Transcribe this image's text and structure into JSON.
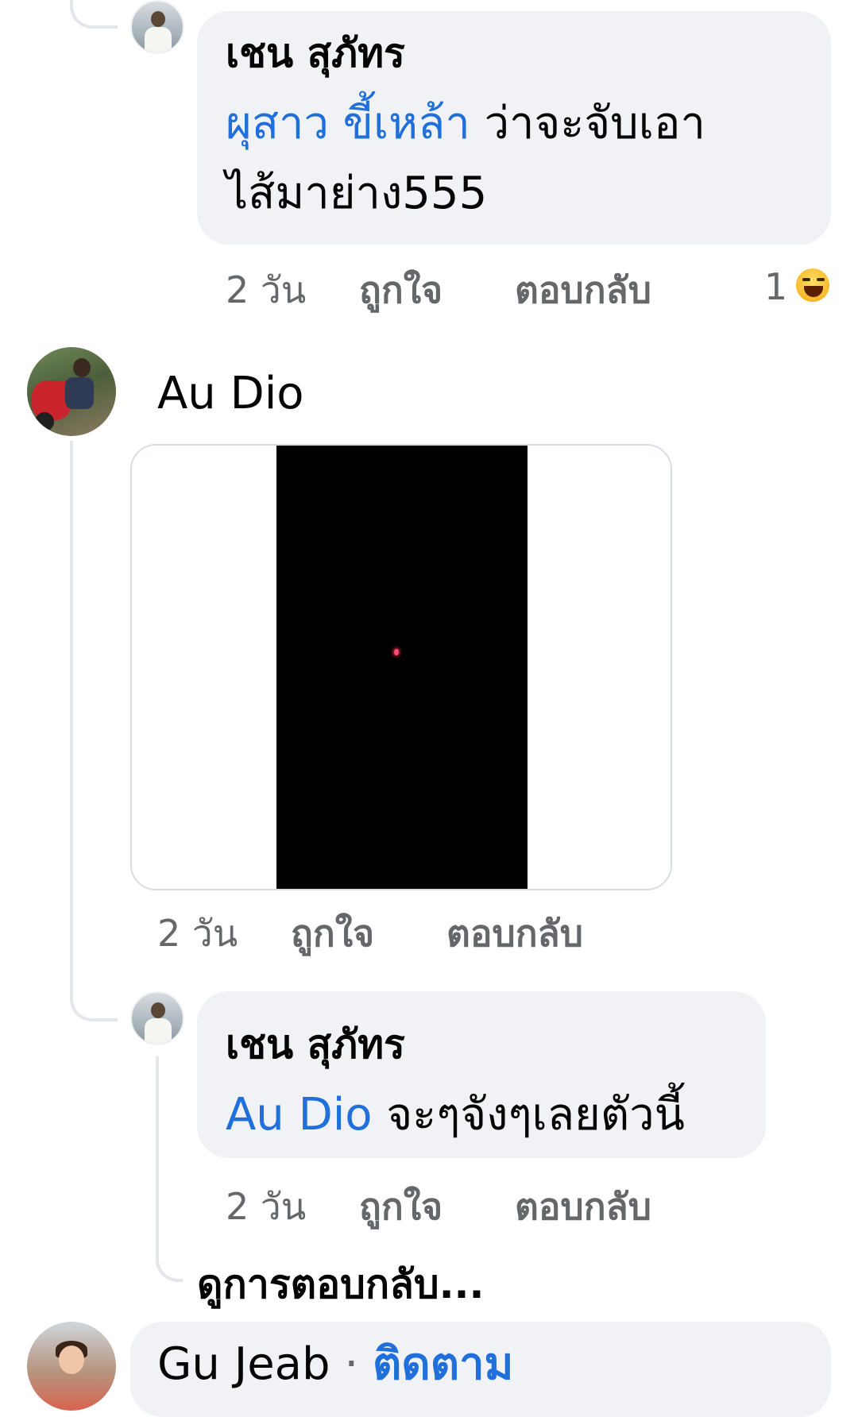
{
  "comments": [
    {
      "author": "เชน สุภัทร",
      "mention": "ผุสาว ขี้เหล้า",
      "text_line1": " ว่าจะจับเอา",
      "text_line2": "ไส้มาย่าง555",
      "time": "2 วัน",
      "like_label": "ถูกใจ",
      "reply_label": "ตอบกลับ",
      "reaction_count": "1",
      "reaction_icon": "haha-icon"
    },
    {
      "author": "Au Dio",
      "time": "2 วัน",
      "like_label": "ถูกใจ",
      "reply_label": "ตอบกลับ",
      "attachment_icon": "photo"
    },
    {
      "author": "เชน สุภัทร",
      "mention": "Au Dio",
      "text": " จะๆจังๆเลยตัวนี้",
      "time": "2 วัน",
      "like_label": "ถูกใจ",
      "reply_label": "ตอบกลับ"
    }
  ],
  "view_replies_label": "ดูการตอบกลับ...",
  "next_comment": {
    "author": "Gu Jeab",
    "separator": "·",
    "follow_label": "ติดตาม"
  },
  "colors": {
    "bubble": "#f0f2f5",
    "mention": "#216fdb",
    "meta_text": "#65676b",
    "thread_line": "#e4e6eb"
  }
}
